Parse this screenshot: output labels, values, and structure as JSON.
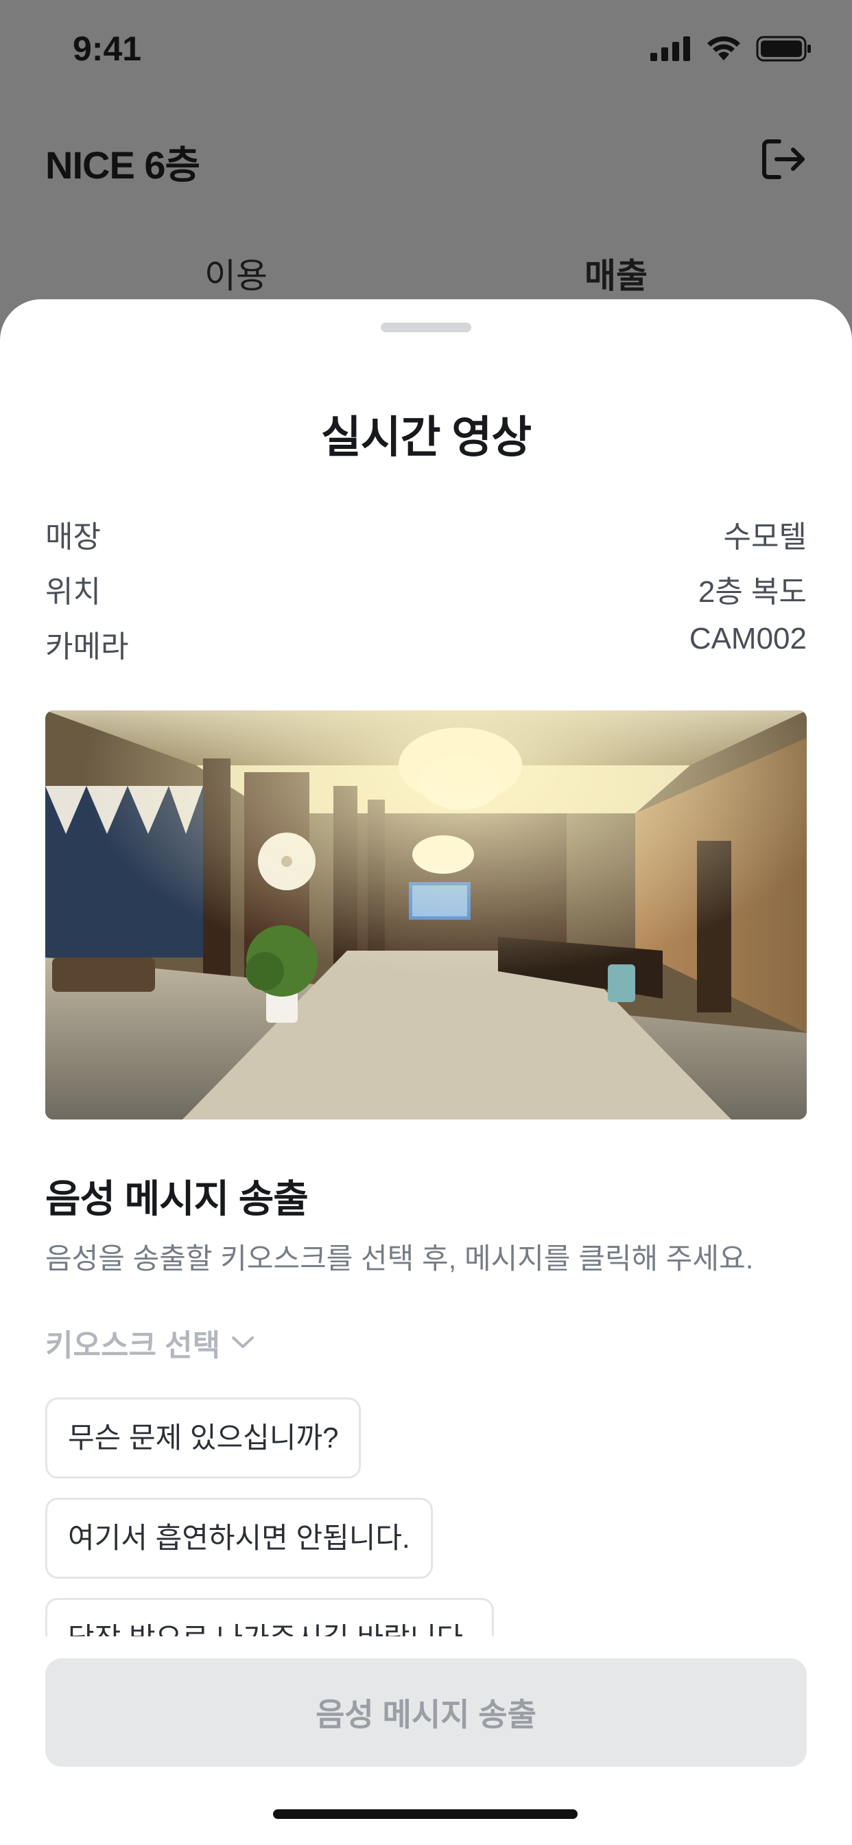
{
  "status_bar": {
    "time": "9:41"
  },
  "header": {
    "title": "NICE 6층"
  },
  "tabs": [
    {
      "label": "이용"
    },
    {
      "label": "매출"
    }
  ],
  "sheet": {
    "title": "실시간 영상",
    "info": [
      {
        "label": "매장",
        "value": "수모텔"
      },
      {
        "label": "위치",
        "value": "2층 복도"
      },
      {
        "label": "카메라",
        "value": "CAM002"
      }
    ]
  },
  "voice": {
    "title": "음성 메시지 송출",
    "description": "음성을 송출할 키오스크를 선택 후, 메시지를 클릭해 주세요.",
    "kiosk_select_label": "키오스크 선택",
    "messages": [
      "무슨 문제 있으십니까?",
      "여기서 흡연하시면 안됩니다.",
      "당장 밖으로 나가주시길 바랍니다."
    ],
    "send_button_label": "음성 메시지 송출"
  },
  "colors": {
    "dim_background": "#7b7b7b",
    "sheet_background": "#ffffff",
    "text_primary": "#17191c",
    "text_secondary": "#767c85",
    "button_disabled_bg": "#e6e7e9",
    "button_disabled_text": "#9a9ea5"
  }
}
